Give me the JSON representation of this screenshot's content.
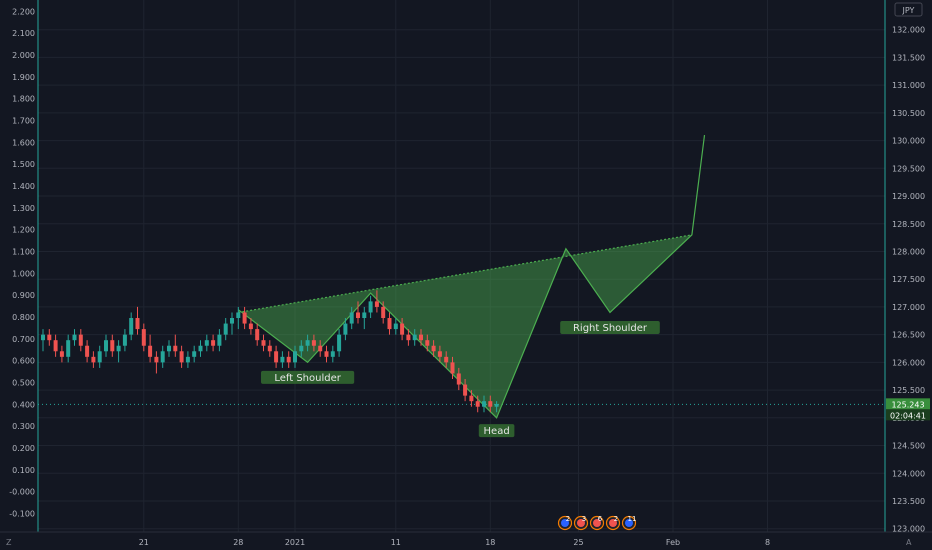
{
  "currency_label": "JPY",
  "footer_left": "Z",
  "footer_right": "A",
  "price_tag": "125.243",
  "timer_tag": "02:04:41",
  "patterns": {
    "left_shoulder": "Left Shoulder",
    "head": "Head",
    "right_shoulder": "Right Shoulder"
  },
  "event_badges": [
    "2",
    "3",
    "6",
    "2",
    "11"
  ],
  "colors": {
    "background": "#131722",
    "up": "#26a69a",
    "down": "#ef5350",
    "pattern": "#4caf50",
    "label_bg": "#2e5e2e",
    "axis_line": "#26a69a",
    "price_tag_bg": "#388e3c"
  },
  "chart_data": {
    "type": "candlestick",
    "left_axis": {
      "ticks": [
        "2.200",
        "2.100",
        "2.000",
        "1.900",
        "1.800",
        "1.700",
        "1.600",
        "1.500",
        "1.400",
        "1.300",
        "1.200",
        "1.100",
        "1.000",
        "0.900",
        "0.800",
        "0.700",
        "0.600",
        "0.500",
        "0.400",
        "0.300",
        "0.200",
        "0.100",
        "-0.000",
        "-0.100"
      ],
      "ylim": [
        -0.1,
        2.2
      ]
    },
    "right_axis": {
      "ticks": [
        "132.000",
        "131.500",
        "131.000",
        "130.500",
        "130.000",
        "129.500",
        "129.000",
        "128.500",
        "128.000",
        "127.500",
        "127.000",
        "126.500",
        "126.000",
        "125.500",
        "125.000",
        "124.500",
        "124.000",
        "123.500",
        "123.000"
      ],
      "ylim": [
        123.0,
        132.0
      ]
    },
    "x_ticks": [
      {
        "label": "21",
        "index": 16
      },
      {
        "label": "28",
        "index": 31
      },
      {
        "label": "2021",
        "index": 40
      },
      {
        "label": "11",
        "index": 56
      },
      {
        "label": "18",
        "index": 71
      },
      {
        "label": "25",
        "index": 85
      },
      {
        "label": "Feb",
        "index": 100
      },
      {
        "label": "8",
        "index": 115
      }
    ],
    "candles": [
      [
        126.4,
        126.6,
        126.2,
        126.5
      ],
      [
        126.5,
        126.6,
        126.3,
        126.4
      ],
      [
        126.4,
        126.5,
        126.1,
        126.2
      ],
      [
        126.2,
        126.3,
        126.0,
        126.1
      ],
      [
        126.1,
        126.5,
        126.0,
        126.4
      ],
      [
        126.4,
        126.6,
        126.3,
        126.5
      ],
      [
        126.5,
        126.6,
        126.2,
        126.3
      ],
      [
        126.3,
        126.4,
        126.0,
        126.1
      ],
      [
        126.1,
        126.2,
        125.9,
        126.0
      ],
      [
        126.0,
        126.3,
        125.9,
        126.2
      ],
      [
        126.2,
        126.5,
        126.1,
        126.4
      ],
      [
        126.4,
        126.5,
        126.1,
        126.2
      ],
      [
        126.2,
        126.4,
        126.0,
        126.3
      ],
      [
        126.3,
        126.6,
        126.2,
        126.5
      ],
      [
        126.5,
        126.9,
        126.4,
        126.8
      ],
      [
        126.8,
        127.0,
        126.5,
        126.6
      ],
      [
        126.6,
        126.7,
        126.2,
        126.3
      ],
      [
        126.3,
        126.5,
        126.0,
        126.1
      ],
      [
        126.1,
        126.2,
        125.8,
        126.0
      ],
      [
        126.0,
        126.3,
        125.9,
        126.2
      ],
      [
        126.2,
        126.4,
        126.1,
        126.3
      ],
      [
        126.3,
        126.5,
        126.1,
        126.2
      ],
      [
        126.2,
        126.3,
        125.9,
        126.0
      ],
      [
        126.0,
        126.2,
        125.9,
        126.1
      ],
      [
        126.1,
        126.3,
        126.0,
        126.2
      ],
      [
        126.2,
        126.4,
        126.1,
        126.3
      ],
      [
        126.3,
        126.5,
        126.2,
        126.4
      ],
      [
        126.4,
        126.5,
        126.2,
        126.3
      ],
      [
        126.3,
        126.6,
        126.2,
        126.5
      ],
      [
        126.5,
        126.8,
        126.4,
        126.7
      ],
      [
        126.7,
        126.9,
        126.5,
        126.8
      ],
      [
        126.8,
        127.0,
        126.6,
        126.9
      ],
      [
        126.9,
        127.0,
        126.6,
        126.7
      ],
      [
        126.7,
        126.8,
        126.5,
        126.6
      ],
      [
        126.6,
        126.7,
        126.3,
        126.4
      ],
      [
        126.4,
        126.5,
        126.2,
        126.3
      ],
      [
        126.3,
        126.4,
        126.1,
        126.2
      ],
      [
        126.2,
        126.3,
        125.9,
        126.0
      ],
      [
        126.0,
        126.2,
        125.9,
        126.1
      ],
      [
        126.1,
        126.2,
        125.9,
        126.0
      ],
      [
        126.0,
        126.3,
        125.9,
        126.2
      ],
      [
        126.2,
        126.4,
        126.1,
        126.3
      ],
      [
        126.3,
        126.5,
        126.2,
        126.4
      ],
      [
        126.4,
        126.5,
        126.2,
        126.3
      ],
      [
        126.3,
        126.4,
        126.1,
        126.2
      ],
      [
        126.2,
        126.3,
        126.0,
        126.1
      ],
      [
        126.1,
        126.3,
        126.0,
        126.2
      ],
      [
        126.2,
        126.6,
        126.1,
        126.5
      ],
      [
        126.5,
        126.8,
        126.4,
        126.7
      ],
      [
        126.7,
        127.0,
        126.6,
        126.9
      ],
      [
        126.9,
        127.1,
        126.7,
        126.8
      ],
      [
        126.8,
        127.0,
        126.6,
        126.9
      ],
      [
        126.9,
        127.2,
        126.8,
        127.1
      ],
      [
        127.1,
        127.3,
        126.9,
        127.0
      ],
      [
        127.0,
        127.1,
        126.7,
        126.8
      ],
      [
        126.8,
        126.9,
        126.5,
        126.6
      ],
      [
        126.6,
        126.8,
        126.5,
        126.7
      ],
      [
        126.7,
        126.8,
        126.4,
        126.5
      ],
      [
        126.5,
        126.6,
        126.3,
        126.4
      ],
      [
        126.4,
        126.6,
        126.3,
        126.5
      ],
      [
        126.5,
        126.6,
        126.3,
        126.4
      ],
      [
        126.4,
        126.5,
        126.2,
        126.3
      ],
      [
        126.3,
        126.4,
        126.1,
        126.2
      ],
      [
        126.2,
        126.3,
        126.0,
        126.1
      ],
      [
        126.1,
        126.2,
        125.9,
        126.0
      ],
      [
        126.0,
        126.1,
        125.7,
        125.8
      ],
      [
        125.8,
        125.9,
        125.5,
        125.6
      ],
      [
        125.6,
        125.7,
        125.3,
        125.4
      ],
      [
        125.4,
        125.5,
        125.2,
        125.3
      ],
      [
        125.3,
        125.4,
        125.1,
        125.2
      ],
      [
        125.2,
        125.4,
        125.1,
        125.3
      ],
      [
        125.3,
        125.4,
        125.1,
        125.2
      ],
      [
        125.2,
        125.3,
        125.1,
        125.25
      ]
    ],
    "pattern_lines": {
      "neckline": [
        [
          31,
          126.9
        ],
        [
          103,
          128.3
        ]
      ],
      "path": [
        [
          31,
          126.95
        ],
        [
          42,
          126.0
        ],
        [
          52,
          127.25
        ],
        [
          72,
          125.0
        ],
        [
          83,
          128.05
        ],
        [
          90,
          126.9
        ],
        [
          103,
          128.3
        ],
        [
          105,
          130.1
        ]
      ]
    },
    "current_price": 125.243,
    "label_anchors": {
      "left_shoulder": [
        42,
        125.72
      ],
      "head": [
        72,
        124.76
      ],
      "right_shoulder": [
        90,
        126.62
      ]
    }
  }
}
